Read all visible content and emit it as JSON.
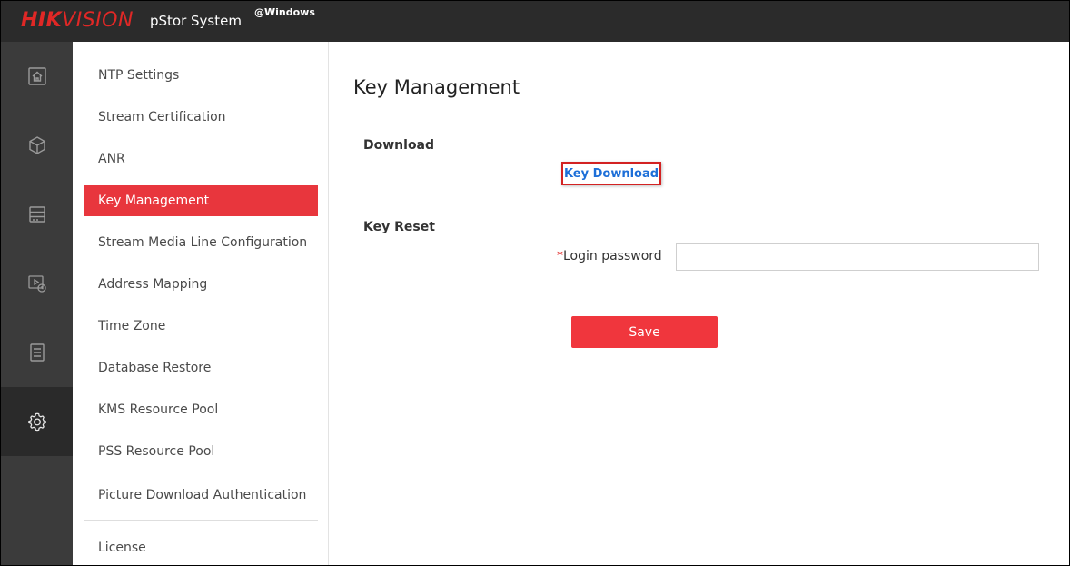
{
  "header": {
    "brand": "HIKVISION",
    "product": "pStor System",
    "platform": "@Windows"
  },
  "left_nav": {
    "icons": [
      {
        "name": "home-icon",
        "active": false
      },
      {
        "name": "cube-icon",
        "active": false
      },
      {
        "name": "storage-icon",
        "active": false
      },
      {
        "name": "video-monitor-icon",
        "active": false
      },
      {
        "name": "document-icon",
        "active": false
      },
      {
        "name": "gear-icon",
        "active": true
      }
    ]
  },
  "submenu": {
    "items": [
      {
        "label": "NTP Settings",
        "active": false
      },
      {
        "label": "Stream Certification",
        "active": false
      },
      {
        "label": "ANR",
        "active": false
      },
      {
        "label": "Key Management",
        "active": true
      },
      {
        "label": "Stream Media Line Configuration",
        "active": false
      },
      {
        "label": "Address Mapping",
        "active": false
      },
      {
        "label": "Time Zone",
        "active": false
      },
      {
        "label": "Database Restore",
        "active": false
      },
      {
        "label": "KMS Resource Pool",
        "active": false
      },
      {
        "label": "PSS Resource Pool",
        "active": false
      },
      {
        "label": "Picture Download Authentication",
        "active": false
      },
      {
        "label": "License",
        "active": false
      }
    ]
  },
  "main": {
    "title": "Key Management",
    "download": {
      "label": "Download",
      "link": "Key Download"
    },
    "key_reset": {
      "label": "Key Reset",
      "required_mark": "*",
      "password_label": "Login password",
      "password_value": ""
    },
    "save_label": "Save"
  },
  "colors": {
    "accent": "#e8363d",
    "topbar": "#2b2b2b",
    "iconbar": "#3b3b3b",
    "link": "#1d6fd8"
  }
}
